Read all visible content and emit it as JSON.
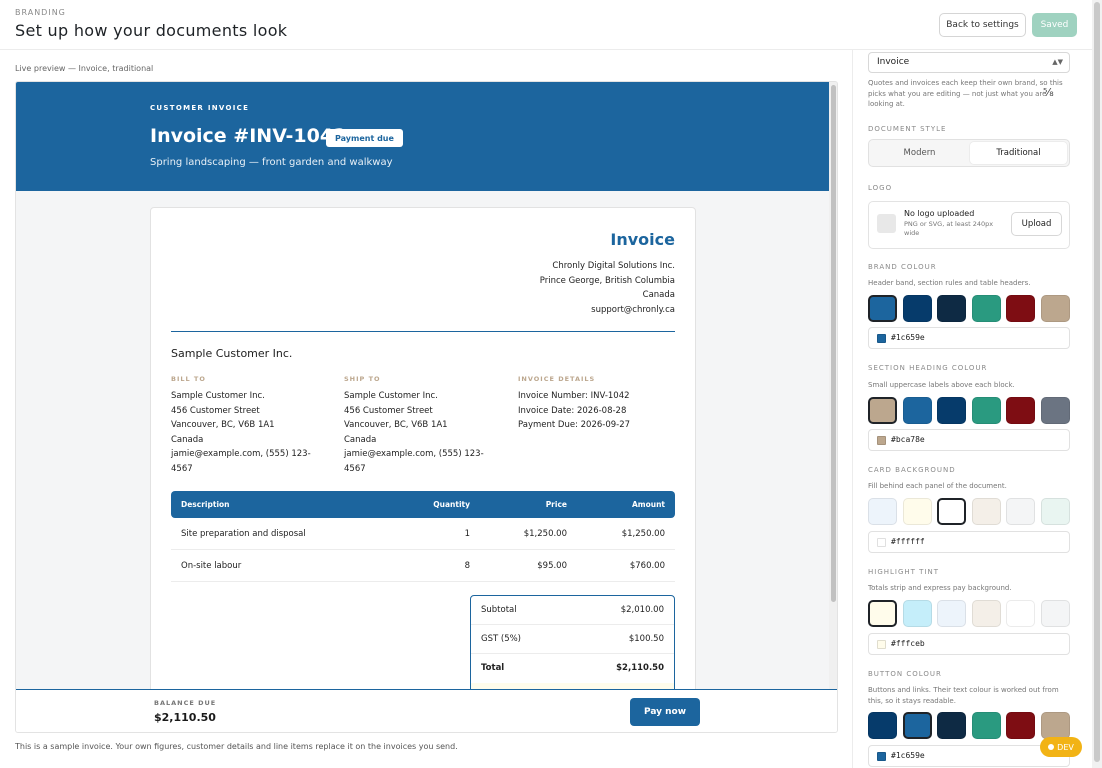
{
  "header": {
    "eyebrow": "BRANDING",
    "title": "Set up how your documents look",
    "back_label": "Back to settings",
    "saved_label": "Saved"
  },
  "preview": {
    "label": "Live preview — Invoice, traditional",
    "band_eyebrow": "CUSTOMER INVOICE",
    "band_title": "Invoice #INV-1042",
    "badge": "Payment due",
    "band_subtitle": "Spring landscaping — front garden and walkway",
    "doc_kind": "Invoice",
    "company": [
      "Chronly Digital Solutions Inc.",
      "Prince George, British Columbia",
      "Canada",
      "support@chronly.ca"
    ],
    "customer_name": "Sample Customer Inc.",
    "bill_to": {
      "heading": "BILL TO",
      "lines": [
        "Sample Customer Inc.",
        "456 Customer Street",
        "Vancouver, BC, V6B 1A1",
        "Canada",
        "jamie@example.com, (555) 123-",
        "4567"
      ]
    },
    "ship_to": {
      "heading": "SHIP TO",
      "lines": [
        "Sample Customer Inc.",
        "456 Customer Street",
        "Vancouver, BC, V6B 1A1",
        "Canada",
        "jamie@example.com, (555) 123-",
        "4567"
      ]
    },
    "details": {
      "heading": "INVOICE DETAILS",
      "lines": [
        "Invoice Number: INV-1042",
        "Invoice Date: 2026-08-28",
        "Payment Due: 2026-09-27"
      ]
    },
    "table": {
      "headers": [
        "Description",
        "Quantity",
        "Price",
        "Amount"
      ],
      "rows": [
        [
          "Site preparation and disposal",
          "1",
          "$1,250.00",
          "$1,250.00"
        ],
        [
          "On-site labour",
          "8",
          "$95.00",
          "$760.00"
        ]
      ]
    },
    "totals": [
      [
        "Subtotal",
        "$2,010.00"
      ],
      [
        "GST (5%)",
        "$100.50"
      ],
      [
        "Total",
        "$2,110.50"
      ]
    ],
    "balance_label": "BALANCE DUE",
    "balance_amount": "$2,110.50",
    "pay_label": "Pay now",
    "footnote": "This is a sample invoice. Your own figures, customer details and line items replace it on the invoices you send."
  },
  "panel": {
    "doc_select": "Invoice",
    "doc_help": "Quotes and invoices each keep their own brand, so this picks what you are editing — not just what you are looking at.",
    "style_label": "DOCUMENT STYLE",
    "style_options": [
      "Modern",
      "Traditional"
    ],
    "style_selected": 1,
    "logo_label": "LOGO",
    "logo_title": "No logo uploaded",
    "logo_sub": "PNG or SVG, at least 240px wide",
    "upload_label": "Upload",
    "brand": {
      "label": "BRAND COLOUR",
      "help": "Header band, section rules and table headers.",
      "swatches": [
        "#1c659e",
        "#063b6b",
        "#0e2a44",
        "#2a9a80",
        "#7e0d13",
        "#bca78e"
      ],
      "selected": 0,
      "hex": "#1c659e"
    },
    "heading": {
      "label": "SECTION HEADING COLOUR",
      "help": "Small uppercase labels above each block.",
      "swatches": [
        "#bca78e",
        "#1c659e",
        "#063b6b",
        "#2a9a80",
        "#7e0d13",
        "#6b7482"
      ],
      "selected": 0,
      "hex": "#bca78e"
    },
    "card": {
      "label": "CARD BACKGROUND",
      "help": "Fill behind each panel of the document.",
      "swatches": [
        "#edf4fb",
        "#fffceb",
        "#ffffff",
        "#f4efe8",
        "#f4f5f6",
        "#e9f5f1"
      ],
      "selected": 2,
      "hex": "#ffffff"
    },
    "highlight": {
      "label": "HIGHLIGHT TINT",
      "help": "Totals strip and express pay background.",
      "swatches": [
        "#fffceb",
        "#c5eefa",
        "#edf4fb",
        "#f4efe8",
        "#ffffff",
        "#f4f5f6"
      ],
      "selected": 0,
      "hex": "#fffceb"
    },
    "button": {
      "label": "BUTTON COLOUR",
      "help": "Buttons and links. Their text colour is worked out from this, so it stays readable.",
      "swatches": [
        "#063b6b",
        "#1c659e",
        "#0e2a44",
        "#2a9a80",
        "#7e0d13",
        "#bca78e"
      ],
      "selected": 1,
      "hex": "#1c659e"
    },
    "dev_label": "DEV"
  }
}
